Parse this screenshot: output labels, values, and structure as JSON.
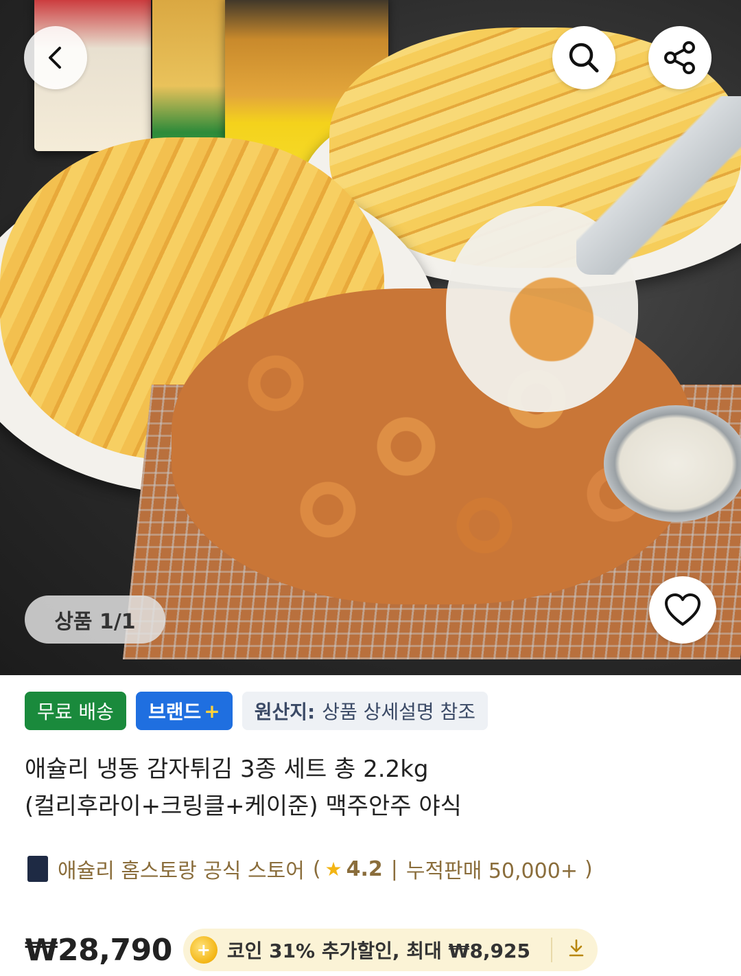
{
  "hero": {
    "counter_label": "상품 1/1",
    "icons": {
      "back": "chevron-left-icon",
      "search": "search-icon",
      "share": "share-icon",
      "wishlist": "heart-icon"
    }
  },
  "tags": {
    "free_shipping": "무료 배송",
    "brand": "브랜드",
    "brand_plus": "+",
    "origin_key": "원산지:",
    "origin_value": "상품 상세설명 참조"
  },
  "product": {
    "title_line1": "애슐리 냉동 감자튀김 3종 세트 총 2.2kg",
    "title_line2": "(컬리후라이+크링클+케이준) 맥주안주 야식"
  },
  "store": {
    "name": "애슐리 홈스토랑 공식 스토어",
    "open_paren": "(",
    "rating": "4.2",
    "separator": "|",
    "sales": "누적판매 50,000+",
    "close_paren": ")"
  },
  "price": {
    "amount": "₩28,790",
    "coin_text": "코인 31% 추가할인, 최대 ₩8,925"
  },
  "colors": {
    "free_shipping": "#1a8a3c",
    "brand": "#1f6fe0",
    "store_text": "#8a6d3b",
    "coin_bg": "#fbf3d6"
  }
}
